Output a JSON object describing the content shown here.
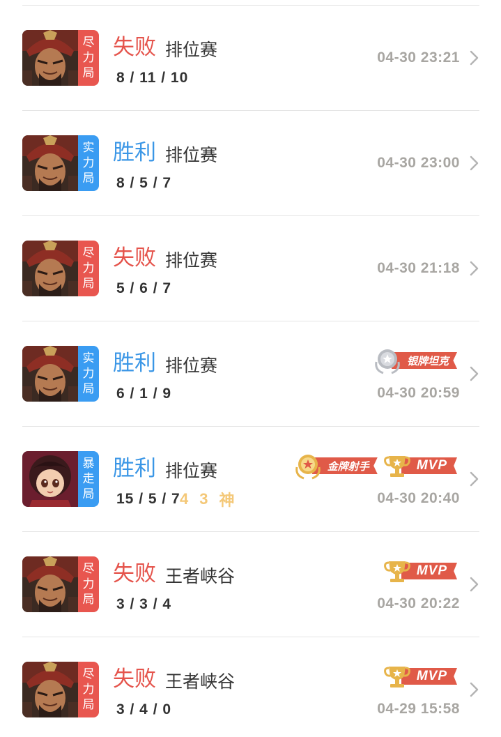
{
  "colors": {
    "lose": "#e5544c",
    "win": "#3a96e6",
    "tag_red": "#e8564f",
    "tag_blue": "#3a9cf2",
    "time": "#a8a6a2",
    "ribbon": "#e05a48",
    "gold": "#e7b44a",
    "silver": "#b9bcc2"
  },
  "matches": [
    {
      "hero": "warrior-hero-avatar",
      "mode_tag": [
        "尽",
        "力",
        "局"
      ],
      "tag_color": "red",
      "result": "失败",
      "outcome": "lose",
      "game_mode": "排位赛",
      "kda": "8 / 11 / 10",
      "time": "04-30 23:21",
      "badges": []
    },
    {
      "hero": "warrior-hero-avatar",
      "mode_tag": [
        "实",
        "力",
        "局"
      ],
      "tag_color": "blue",
      "result": "胜利",
      "outcome": "win",
      "game_mode": "排位赛",
      "kda": "8 / 5 / 7",
      "time": "04-30 23:00",
      "badges": []
    },
    {
      "hero": "warrior-hero-avatar",
      "mode_tag": [
        "尽",
        "力",
        "局"
      ],
      "tag_color": "red",
      "result": "失败",
      "outcome": "lose",
      "game_mode": "排位赛",
      "kda": "5 / 6 / 7",
      "time": "04-30 21:18",
      "badges": []
    },
    {
      "hero": "warrior-hero-avatar",
      "mode_tag": [
        "实",
        "力",
        "局"
      ],
      "tag_color": "blue",
      "result": "胜利",
      "outcome": "win",
      "game_mode": "排位赛",
      "kda": "6 / 1 / 9",
      "time": "04-30 20:59",
      "badges": [
        {
          "type": "silver-medal",
          "label": "银牌坦克"
        }
      ]
    },
    {
      "hero": "archer-girl-hero-avatar",
      "mode_tag": [
        "暴",
        "走",
        "局"
      ],
      "tag_color": "blue",
      "result": "胜利",
      "outcome": "win",
      "game_mode": "排位赛",
      "kda": "15 / 5 / 7",
      "streaks": [
        "4",
        "3",
        "神"
      ],
      "time": "04-30 20:40",
      "badges": [
        {
          "type": "gold-medal",
          "label": "金牌射手"
        },
        {
          "type": "mvp-trophy",
          "label": "MVP"
        }
      ]
    },
    {
      "hero": "warrior-hero-avatar",
      "mode_tag": [
        "尽",
        "力",
        "局"
      ],
      "tag_color": "red",
      "result": "失败",
      "outcome": "lose",
      "game_mode": "王者峡谷",
      "kda": "3 / 3 / 4",
      "time": "04-30 20:22",
      "badges": [
        {
          "type": "mvp-trophy",
          "label": "MVP"
        }
      ]
    },
    {
      "hero": "warrior-hero-avatar",
      "mode_tag": [
        "尽",
        "力",
        "局"
      ],
      "tag_color": "red",
      "result": "失败",
      "outcome": "lose",
      "game_mode": "王者峡谷",
      "kda": "3 / 4 / 0",
      "time": "04-29 15:58",
      "badges": [
        {
          "type": "mvp-trophy",
          "label": "MVP"
        }
      ]
    }
  ]
}
